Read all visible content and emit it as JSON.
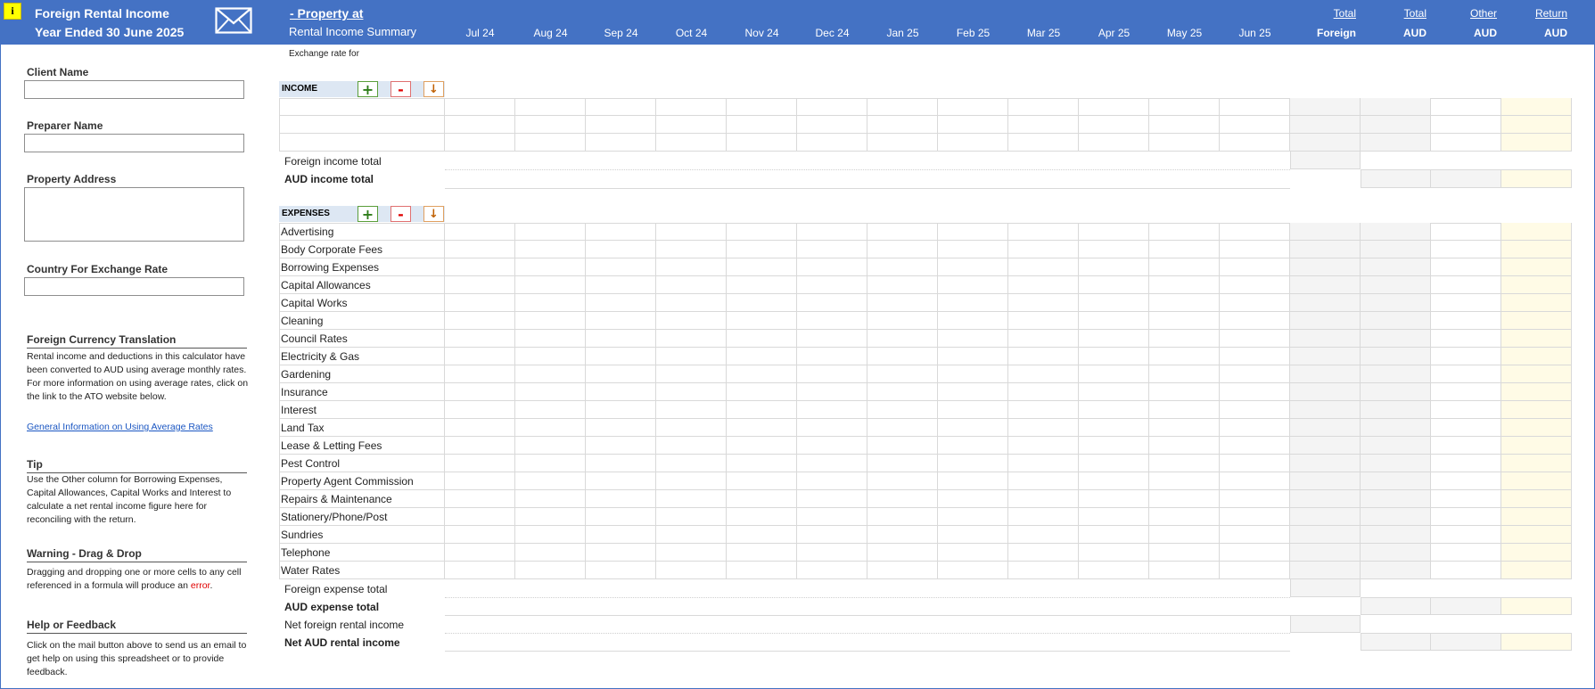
{
  "header": {
    "info_label": "i",
    "title": "Foreign Rental Income",
    "subtitle": "Year Ended 30 June 2025",
    "property_at": "- Property at",
    "summary_title": "Rental Income Summary",
    "months": [
      "Jul 24",
      "Aug 24",
      "Sep 24",
      "Oct 24",
      "Nov 24",
      "Dec 24",
      "Jan 25",
      "Feb 25",
      "Mar 25",
      "Apr 25",
      "May 25",
      "Jun 25"
    ],
    "summary_columns": [
      {
        "link": "Total",
        "unit": "Foreign"
      },
      {
        "link": "Total",
        "unit": "AUD"
      },
      {
        "link": "Other",
        "unit": "AUD"
      },
      {
        "link": "Return",
        "unit": "AUD"
      }
    ]
  },
  "exchange_rate_label": "Exchange rate for",
  "sidebar": {
    "client_name_label": "Client Name",
    "preparer_name_label": "Preparer Name",
    "property_address_label": "Property Address",
    "country_label": "Country For Exchange Rate",
    "fct_heading": "Foreign Currency Translation",
    "fct_text": "Rental income and deductions in this calculator have been converted to AUD using average monthly rates.  For more information on using average rates, click on the link to the ATO website below.",
    "fct_link": "General Information on Using Average Rates",
    "tip_heading": "Tip",
    "tip_text": "Use the Other column for Borrowing Expenses, Capital Allowances, Capital Works and Interest to calculate a net rental income figure here for reconciling with the return.",
    "warning_heading": "Warning - Drag & Drop",
    "warning_text_pre": "Dragging and dropping one or more cells to any cell referenced in a formula will produce an ",
    "warning_error": "error",
    "warning_text_post": ".",
    "help_heading": "Help or Feedback",
    "help_text": "Click on the mail button above to send us an email to get help on using this spreadsheet or to provide feedback."
  },
  "income": {
    "label": "INCOME",
    "add": "+",
    "remove": "-",
    "down": "↓",
    "foreign_total_label": "Foreign income total",
    "aud_total_label": "AUD income total"
  },
  "expenses": {
    "label": "EXPENSES",
    "add": "+",
    "remove": "-",
    "down": "↓",
    "items": [
      "Advertising",
      "Body Corporate Fees",
      "Borrowing Expenses",
      "Capital Allowances",
      "Capital Works",
      "Cleaning",
      "Council Rates",
      "Electricity & Gas",
      "Gardening",
      "Insurance",
      "Interest",
      "Land Tax",
      "Lease & Letting Fees",
      "Pest Control",
      "Property Agent Commission",
      "Repairs & Maintenance",
      "Stationery/Phone/Post",
      "Sundries",
      "Telephone",
      "Water Rates"
    ],
    "foreign_total_label": "Foreign expense total",
    "aud_total_label": "AUD expense total",
    "net_foreign_label": "Net foreign rental income",
    "net_aud_label": "Net AUD rental income"
  }
}
